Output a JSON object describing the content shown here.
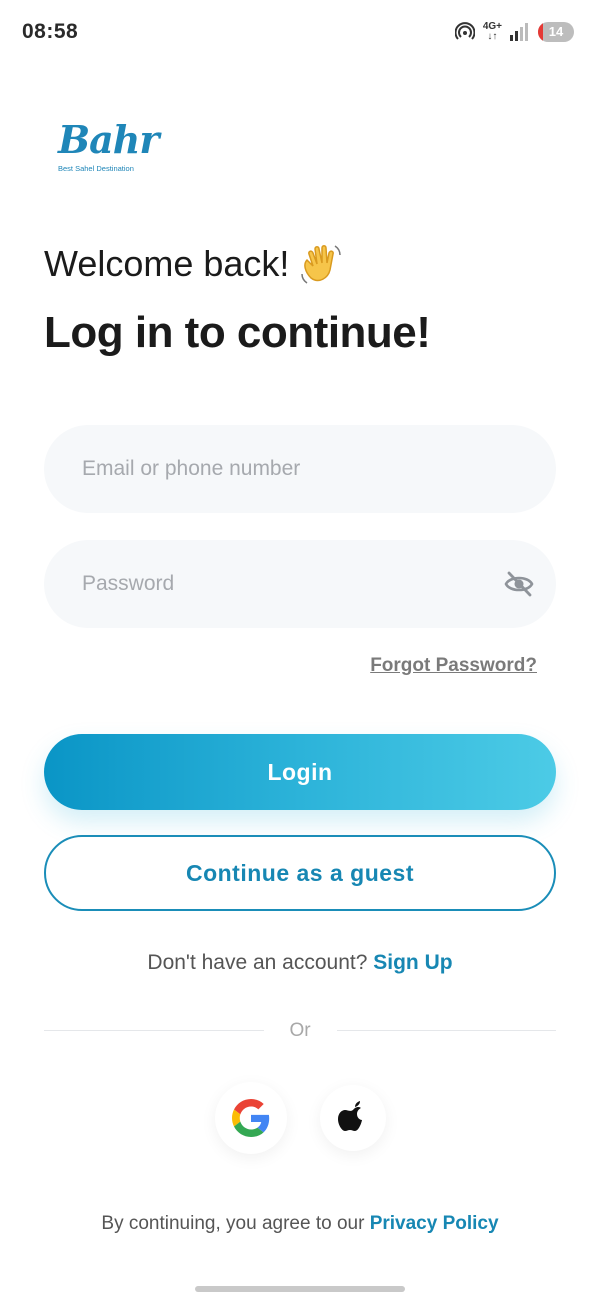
{
  "status_bar": {
    "time": "08:58",
    "network": "4G+",
    "battery_level": "14",
    "battery_fill_percent": 14,
    "battery_color": "#e53935"
  },
  "logo": {
    "wordmark": "Bahr",
    "tagline": "Best Sahel Destination"
  },
  "header": {
    "welcome": "Welcome back!",
    "welcome_emoji": "👋",
    "title": "Log in to continue!"
  },
  "form": {
    "email_placeholder": "Email or phone number",
    "email_value": "",
    "password_placeholder": "Password",
    "password_value": "",
    "password_toggle_icon": "eye-slash-icon",
    "forgot_password": "Forgot Password?"
  },
  "actions": {
    "login_label": "Login",
    "guest_label": "Continue as a guest"
  },
  "signup": {
    "prompt": "Don't have an account?",
    "link": "Sign Up"
  },
  "divider": {
    "label": "Or"
  },
  "social": [
    {
      "name": "google",
      "icon": "google-icon"
    },
    {
      "name": "apple",
      "icon": "apple-icon"
    }
  ],
  "footer": {
    "terms_prefix": "By continuing, you agree to our",
    "terms_link": "Privacy Policy"
  },
  "colors": {
    "accent": "#1787b3",
    "login_gradient_start": "#0a95c6",
    "login_gradient_end": "#4ccbe6",
    "field_background": "#f6f8fa"
  }
}
